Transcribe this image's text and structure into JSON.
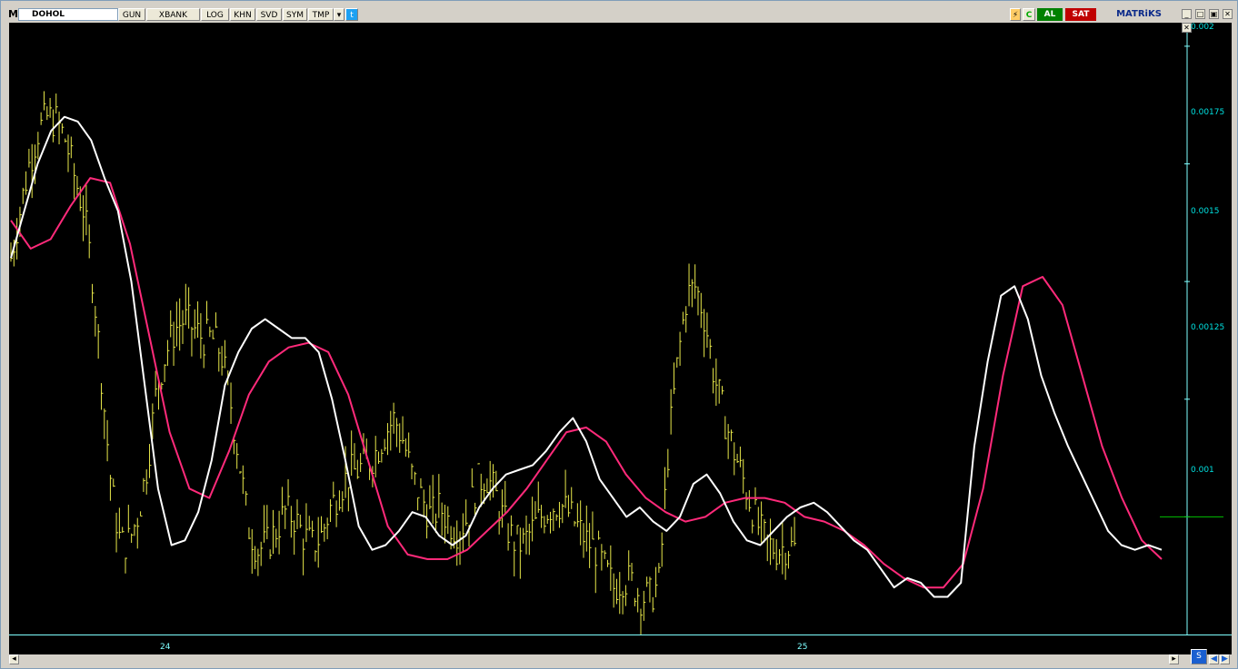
{
  "toolbar": {
    "logo": "M",
    "symbol": "DOHOL",
    "buttons": [
      "GUN",
      "XBANK",
      "LOG",
      "KHN",
      "SVD",
      "SYM",
      "TMP"
    ],
    "buy_label": "AL",
    "sell_label": "SAT",
    "brand": "MATRiKS"
  },
  "chart": {
    "y_labels": [
      "0.002",
      "0.00175",
      "0.0015",
      "0.00125",
      "0.001"
    ],
    "x_labels": [
      "24",
      "25"
    ],
    "colors": {
      "background": "#000000",
      "bars": "#e8e84a",
      "fast_ma": "#ffffff",
      "slow_ma": "#ff2a7a",
      "axis": "#7fffff"
    }
  },
  "chart_data": {
    "type": "line",
    "ylim": [
      0.00075,
      0.00205
    ],
    "x": [
      0,
      10,
      20,
      30,
      40,
      50,
      60,
      70,
      80,
      90,
      100,
      110,
      120,
      130,
      140,
      150,
      160,
      170,
      180,
      190,
      200,
      210,
      220,
      230,
      240,
      250,
      260,
      270,
      280,
      290,
      300,
      310,
      320,
      330,
      340,
      350,
      360,
      370,
      380,
      390,
      400,
      410,
      420,
      430,
      440,
      450,
      460,
      470,
      480,
      490,
      500,
      510,
      520,
      530,
      540,
      550,
      560,
      570,
      580,
      590,
      600,
      610,
      620,
      630,
      640,
      650,
      660,
      670,
      680,
      690,
      700,
      710,
      720,
      730,
      740,
      750,
      760,
      770,
      780,
      790,
      800,
      810,
      820,
      830,
      840,
      850,
      860,
      870,
      880,
      890,
      900,
      910,
      920,
      930,
      940,
      950,
      960,
      970,
      980,
      990,
      1000,
      1010,
      1020,
      1030,
      1040,
      1050,
      1060,
      1070,
      1080,
      1090,
      1100,
      1110,
      1120,
      1130,
      1140,
      1150,
      1160,
      1170,
      1180,
      1190,
      1200,
      1210,
      1220,
      1230,
      1240,
      1250,
      1260
    ],
    "series": [
      {
        "color": "#ffffff",
        "values": [
          0.00155,
          0.00165,
          0.00175,
          0.00182,
          0.00185,
          0.00184,
          0.0018,
          0.00172,
          0.00165,
          0.0015,
          0.00128,
          0.00106,
          0.00094,
          0.00095,
          0.00101,
          0.00112,
          0.00128,
          0.00135,
          0.0014,
          0.00142,
          0.0014,
          0.00138,
          0.00138,
          0.00135,
          0.00125,
          0.00112,
          0.00098,
          0.00093,
          0.00094,
          0.00097,
          0.00101,
          0.001,
          0.00096,
          0.00094,
          0.00096,
          0.00102,
          0.00106,
          0.00109,
          0.0011,
          0.00111,
          0.00114,
          0.00118,
          0.00121,
          0.00116,
          0.00108,
          0.00104,
          0.001,
          0.00102,
          0.00099,
          0.00097,
          0.001,
          0.00107,
          0.00109,
          0.00105,
          0.00099,
          0.00095,
          0.00094,
          0.00097,
          0.001,
          0.00102,
          0.00103,
          0.00101,
          0.00098,
          0.00095,
          0.00093,
          0.00089,
          0.00085,
          0.00087,
          0.00086,
          0.00083,
          0.00083,
          0.00086,
          0.00115,
          0.00133,
          0.00147,
          0.00149,
          0.00142,
          0.0013,
          0.00122,
          0.00115,
          0.00109,
          0.00103,
          0.00097,
          0.00094,
          0.00093,
          0.00094,
          0.00093
        ],
        "note_x_range": "first 87 x values"
      },
      {
        "color": "#ff2a7a",
        "values": [
          0.00163,
          0.00157,
          0.00159,
          0.00166,
          0.00172,
          0.00171,
          0.00158,
          0.00138,
          0.00118,
          0.00106,
          0.00104,
          0.00114,
          0.00126,
          0.00133,
          0.00136,
          0.00137,
          0.00135,
          0.00126,
          0.00112,
          0.00098,
          0.00092,
          0.00091,
          0.00091,
          0.00093,
          0.00097,
          0.00101,
          0.00106,
          0.00112,
          0.00118,
          0.00119,
          0.00116,
          0.00109,
          0.00104,
          0.00101,
          0.00099,
          0.001,
          0.00103,
          0.00104,
          0.00104,
          0.00103,
          0.001,
          0.00099,
          0.00097,
          0.00094,
          0.0009,
          0.00087,
          0.00085,
          0.00085,
          0.0009,
          0.00106,
          0.0013,
          0.00149,
          0.00151,
          0.00145,
          0.0013,
          0.00115,
          0.00104,
          0.00095,
          0.00091
        ]
      }
    ]
  }
}
